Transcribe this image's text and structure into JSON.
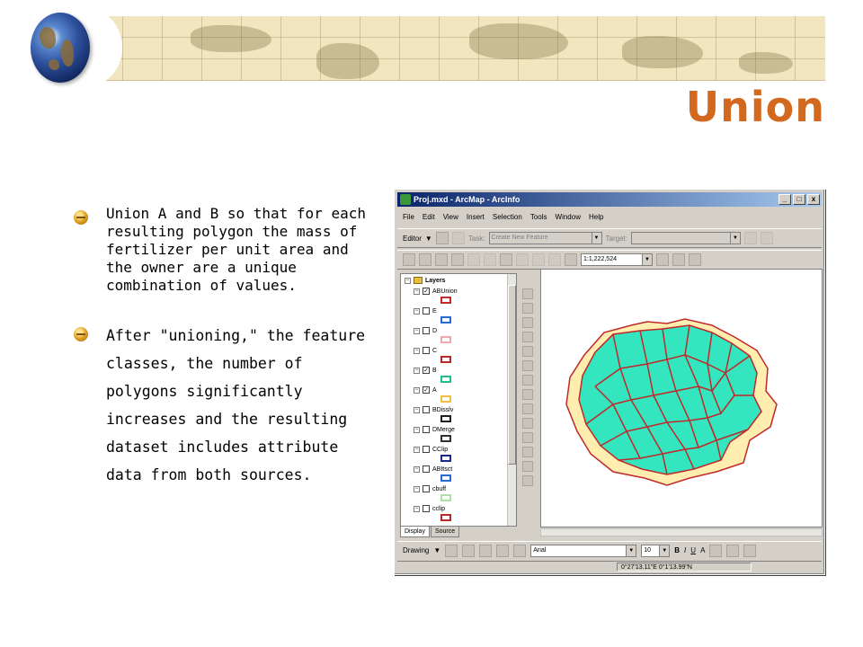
{
  "slide": {
    "title": "Union",
    "bullets": [
      "Union A and B so that for each resulting polygon the mass of fertilizer per unit area and the owner are a unique combination of values.",
      "After \"unioning,\" the feature classes, the number of polygons significantly increases and the resulting dataset includes attribute data from both sources."
    ],
    "colors": {
      "title": "#d2691e",
      "banner": "#f1e6c0"
    }
  },
  "window": {
    "title": "Proj.mxd - ArcMap - ArcInfo",
    "controls": [
      "_",
      "□",
      "x"
    ],
    "menu": [
      "File",
      "Edit",
      "View",
      "Insert",
      "Selection",
      "Tools",
      "Window",
      "Help"
    ],
    "editor_toolbar": {
      "editor_label": "Editor",
      "task_label": "Task:",
      "task_value": "Create New Feature",
      "target_label": "Target:"
    },
    "standard_toolbar": {
      "scale_value": "1:1,222,524"
    },
    "toc": {
      "root": "Layers",
      "layers": [
        {
          "name": "ABUnion",
          "checked": true
        },
        {
          "name": "E",
          "checked": false
        },
        {
          "name": "D",
          "checked": false
        },
        {
          "name": "C",
          "checked": false
        },
        {
          "name": "B",
          "checked": true
        },
        {
          "name": "A",
          "checked": true
        },
        {
          "name": "BDisslv",
          "checked": false
        },
        {
          "name": "DMerge",
          "checked": false
        },
        {
          "name": "CClip",
          "checked": false
        },
        {
          "name": "ABItsct",
          "checked": false
        },
        {
          "name": "cbuff",
          "checked": false
        },
        {
          "name": "cclip",
          "checked": false
        }
      ],
      "tabs": [
        "Display",
        "Source"
      ]
    },
    "drawing_toolbar": {
      "drawing_label": "Drawing",
      "font_value": "Arial",
      "size_value": "10",
      "bold": "B",
      "italic": "I",
      "underline": "U",
      "font_color": "A"
    },
    "status": {
      "coordinates": "0°27'13.11\"E 0°1'13.99\"N"
    },
    "map_colors": {
      "fill_a": "#33e6bf",
      "fill_b": "#ffeeb0",
      "stroke": "#c0282a"
    }
  }
}
